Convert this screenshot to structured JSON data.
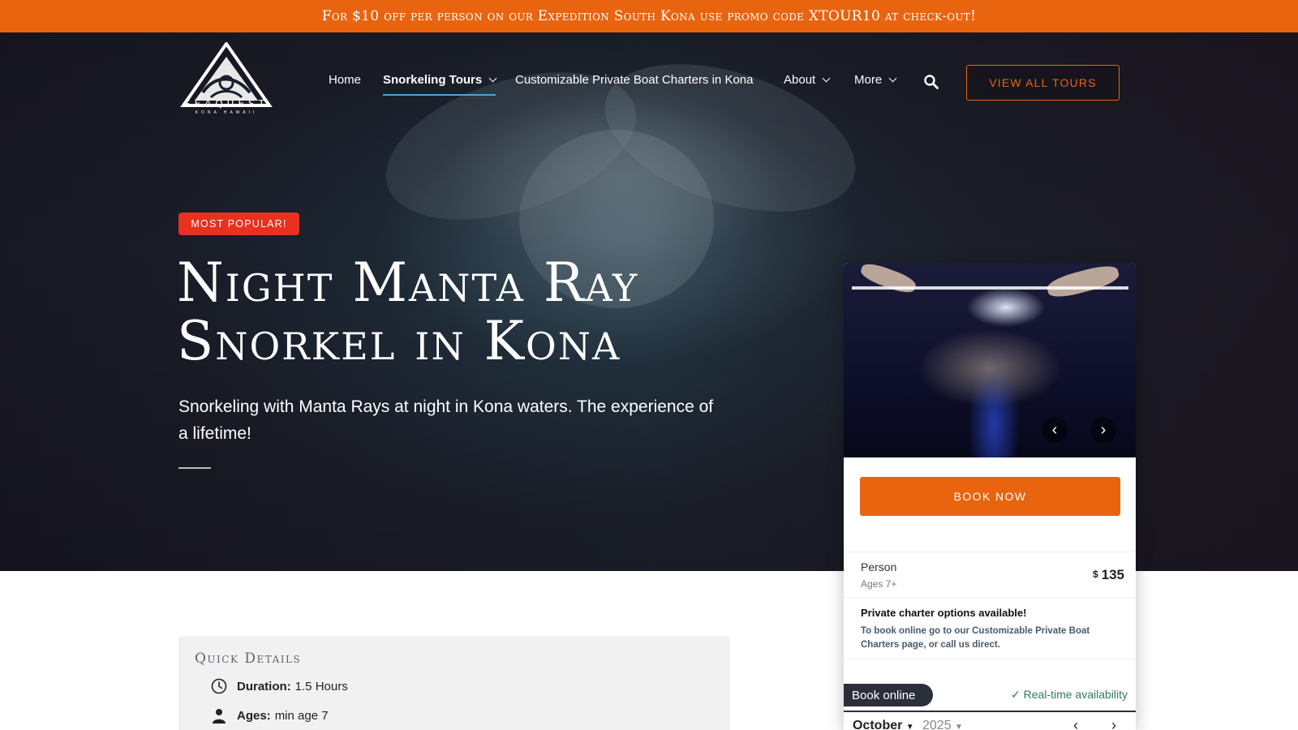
{
  "promo": {
    "text": "For $10 off per person on our Expedition South Kona use promo code XTOUR10 at check-out!"
  },
  "brand": {
    "name": "SEAQUEST",
    "tagline": "KONA HAWAII"
  },
  "nav": {
    "items": [
      {
        "label": "Home",
        "dropdown": false,
        "active": false
      },
      {
        "label": "Snorkeling Tours",
        "dropdown": true,
        "active": true
      },
      {
        "label": "Customizable Private Boat Charters in Kona",
        "dropdown": false,
        "active": false
      },
      {
        "label": "About",
        "dropdown": true,
        "active": false
      },
      {
        "label": "More",
        "dropdown": true,
        "active": false
      }
    ],
    "search_icon": "search-icon",
    "cta": "VIEW ALL TOURS"
  },
  "hero": {
    "badge": "MOST POPULAR!",
    "title_line1": "Night Manta Ray",
    "title_line2": "Snorkel in Kona",
    "subtitle": "Snorkeling with Manta Rays at night in Kona waters. The experience of a lifetime!"
  },
  "booking": {
    "prev_glyph": "‹",
    "next_glyph": "›",
    "book_now": "BOOK NOW",
    "price": {
      "label": "Person",
      "ages": "Ages 7+",
      "currency": "$",
      "amount": "135"
    },
    "charter_title": "Private charter options available!",
    "charter_note": "To book online go to our Customizable Private Boat Charters page, or call us direct.",
    "book_online": "Book online",
    "realtime": "Real-time availability",
    "calendar": {
      "month": "October",
      "year": "2025"
    }
  },
  "quick_details": {
    "title": "Quick Details",
    "duration_label": "Duration:",
    "duration_value": "1.5 Hours",
    "ages_label": "Ages:",
    "ages_value": "min age 7"
  },
  "colors": {
    "accent": "#e8640f",
    "badge": "#e8311f",
    "nav_underline": "#4fa3d9",
    "realtime": "#2e7d5b"
  }
}
